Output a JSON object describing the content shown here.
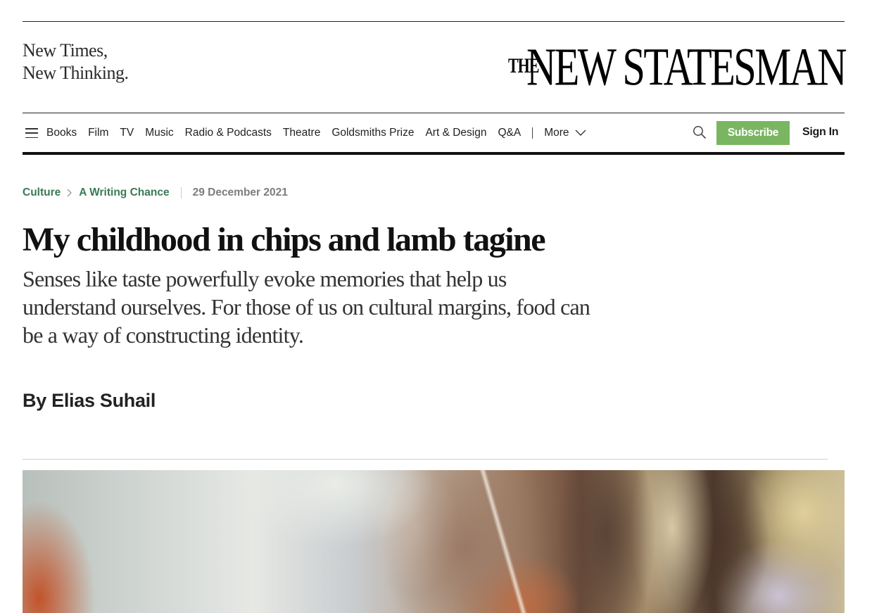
{
  "header": {
    "tagline_line1": "New Times,",
    "tagline_line2": "New Thinking.",
    "logo_the": "THE",
    "logo_main": "NEW STATESMAN"
  },
  "nav": {
    "items": [
      {
        "label": "Books"
      },
      {
        "label": "Film"
      },
      {
        "label": "TV"
      },
      {
        "label": "Music"
      },
      {
        "label": "Radio & Podcasts"
      },
      {
        "label": "Theatre"
      },
      {
        "label": "Goldsmiths Prize"
      },
      {
        "label": "Art & Design"
      },
      {
        "label": "Q&A"
      }
    ],
    "more_label": "More",
    "subscribe_label": "Subscribe",
    "signin_label": "Sign In",
    "icons": [
      "menu-icon",
      "chevron-down-icon",
      "search-icon"
    ]
  },
  "article": {
    "breadcrumb": {
      "section": "Culture",
      "subsection": "A Writing Chance"
    },
    "date": "29 December 2021",
    "headline": "My childhood in chips and lamb tagine",
    "standfirst": "Senses like taste powerfully evoke memories that help us understand ourselves. For those of us on cultural margins, food can be a way of constructing identity.",
    "byline": "By Elias Suhail"
  },
  "colors": {
    "accent_green": "#3a7a55",
    "subscribe_bg": "#7ab661",
    "text": "#111111",
    "muted": "#7d7d7d"
  }
}
